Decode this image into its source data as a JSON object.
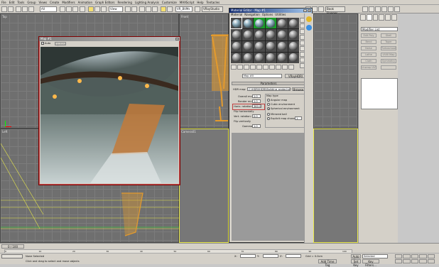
{
  "menubar": {
    "items": [
      "File",
      "Edit",
      "Tools",
      "Group",
      "Views",
      "Create",
      "Modifiers",
      "Animation",
      "Graph Editors",
      "Rendering",
      "Lighting Analysis",
      "Customize",
      "MAXScript",
      "Help",
      "Tentacles"
    ]
  },
  "toolbar": {
    "selection_filter": "All",
    "coord_system": "View",
    "camera_label": "VR_BVMs",
    "vray_label": "VRayStudio",
    "book_flagger": "Book Flagger"
  },
  "viewports": {
    "top_label": "Top",
    "front_label": "Front",
    "left_label": "Left",
    "persp_label": "Camera01"
  },
  "map_window": {
    "title": "Map #1",
    "auto_label": "Auto",
    "update_label": "Update"
  },
  "material_editor": {
    "title": "Material Editor - Map #1",
    "menu": [
      "Material",
      "Navigation",
      "Options",
      "Utilities"
    ],
    "map_name": "Map #0",
    "map_type": "VRayHDRI",
    "rollout_title": "Parameters",
    "hdr_label": "HDR map:",
    "hdr_path": "C:\\HDRI\\HDRI\\Building_probe.hdr",
    "browse_label": "Browse",
    "overall_mult_label": "Overall mult:",
    "overall_mult_value": "1.0",
    "render_mult_label": "Render mult:",
    "render_mult_value": "1.0",
    "horiz_rotation_label": "Horiz. rotation:",
    "horiz_rotation_value": "360.0",
    "flip_horizontally_label": "Flip horizontally",
    "vert_rotation_label": "Vert. rotation:",
    "vert_rotation_value": "0.0",
    "flip_vertically_label": "Flip vertically",
    "gamma_label": "Gamma:",
    "gamma_value": "1.0",
    "map_type_group": "Map type",
    "map_types": [
      "Angular map",
      "Cubic environment",
      "Spherical environment",
      "Mirrored ball",
      "Explicit map channel"
    ],
    "selected_map_type": 2,
    "map_channel_value": "1"
  },
  "command_panel": {
    "modifier_list": "Modifier List",
    "buttons": [
      "Edit Poly",
      "Shell",
      "Bend",
      "Taper",
      "Noise",
      "Turbosmooth",
      "Lathe",
      "UVW Map",
      "Cloth",
      "Symmetry",
      "Unwrap UVW",
      ""
    ]
  },
  "timeline": {
    "frame_counter": "0 / 100",
    "ticks": [
      "0",
      "10",
      "20",
      "30",
      "40",
      "50",
      "60",
      "70",
      "80",
      "90",
      "100"
    ]
  },
  "status": {
    "selection": "None Selected",
    "prompt": "Click and drag to select and move objects",
    "grid": "Grid = 0.0cm",
    "auto_key": "Auto Key",
    "key_filter_mode": "Selected",
    "set_key": "Set Key",
    "key_filters": "Key Filters...",
    "add_time_tag": "Add Time Tag",
    "x_label": "X:",
    "y_label": "Y:",
    "z_label": "Z:"
  }
}
